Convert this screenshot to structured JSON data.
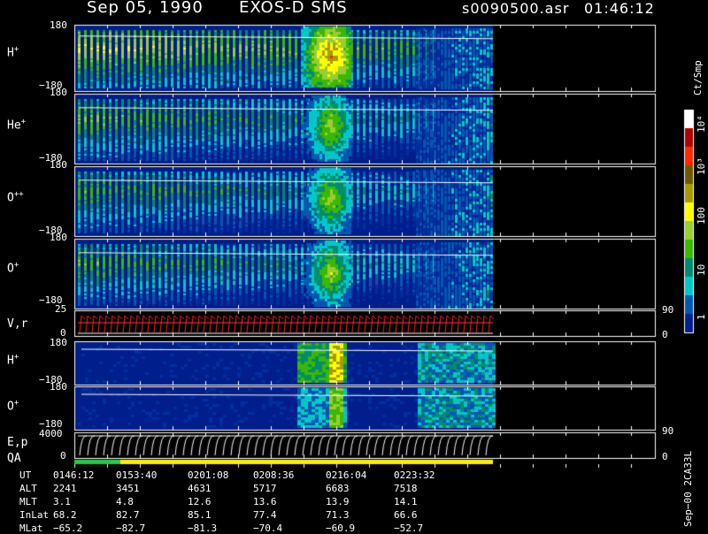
{
  "header": {
    "date": "Sep 05, 1990",
    "instrument": "EXOS-D SMS",
    "filename": "s0090500.asr",
    "time": "01:46:12"
  },
  "panels": [
    {
      "label": "H",
      "sup": "+",
      "ymax": "180",
      "ymin": "−180"
    },
    {
      "label": "He",
      "sup": "+",
      "ymax": "180",
      "ymin": "−180"
    },
    {
      "label": "O",
      "sup": "++",
      "ymax": "180",
      "ymin": "−180"
    },
    {
      "label": "O",
      "sup": "+",
      "ymax": "180",
      "ymin": "−180"
    },
    {
      "label": "V,r",
      "sup": "",
      "ymax": "25",
      "ymin": "0",
      "rmax": "90",
      "rmin": "0"
    },
    {
      "label": "H",
      "sup": "+",
      "ymax": "180",
      "ymin": "−180"
    },
    {
      "label": "O",
      "sup": "+",
      "ymax": "180",
      "ymin": "−180"
    },
    {
      "label": "E,p",
      "sup": "",
      "ymax": "4000",
      "ymin": "0",
      "rmax": "90",
      "rmin": "0"
    }
  ],
  "qa_label": "QA",
  "colorbar": {
    "unit": "Ct/Smp",
    "ticks": [
      "10⁴",
      "10³",
      "100",
      "10",
      "1"
    ],
    "colors": [
      "#ffffff",
      "#b30000",
      "#ff2a00",
      "#6b5a00",
      "#a89b00",
      "#ffff00",
      "#9acd32",
      "#3cb800",
      "#008c6e",
      "#00c8c8",
      "#0058b0",
      "#001e8c"
    ]
  },
  "footer": {
    "rows": [
      {
        "name": "UT",
        "values": [
          "0146:12",
          "0153:40",
          "0201:08",
          "0208:36",
          "0216:04",
          "0223:32"
        ]
      },
      {
        "name": "ALT",
        "values": [
          "2241",
          "3451",
          "4631",
          "5717",
          "6683",
          "7518"
        ]
      },
      {
        "name": "MLT",
        "values": [
          "3.1",
          "4.8",
          "12.6",
          "13.6",
          "13.9",
          "14.1"
        ]
      },
      {
        "name": "InLat",
        "values": [
          "68.2",
          "82.7",
          "85.1",
          "77.4",
          "71.3",
          "66.6"
        ]
      },
      {
        "name": "MLat",
        "values": [
          "−65.2",
          "−82.7",
          "−81.3",
          "−70.4",
          "−60.9",
          "−52.7"
        ]
      }
    ],
    "side_label": "Sep−00 2CA33L"
  },
  "chart_data": {
    "type": "heatmap",
    "title": "Sep 05, 1990   EXOS-D SMS",
    "x_ticks": [
      "0146:12",
      "0153:40",
      "0201:08",
      "0208:36",
      "0216:04",
      "0223:32"
    ],
    "colorbar_range": [
      1,
      10000
    ],
    "colorbar_scale": "log",
    "panels": [
      {
        "name": "H+",
        "ylim": [
          -180,
          180
        ]
      },
      {
        "name": "He+",
        "ylim": [
          -180,
          180
        ]
      },
      {
        "name": "O++",
        "ylim": [
          -180,
          180
        ]
      },
      {
        "name": "O+",
        "ylim": [
          -180,
          180
        ]
      },
      {
        "name": "V,r",
        "ylim": [
          0,
          25
        ],
        "right_ylim": [
          0,
          90
        ]
      },
      {
        "name": "H+",
        "ylim": [
          -180,
          180
        ]
      },
      {
        "name": "O+",
        "ylim": [
          -180,
          180
        ]
      },
      {
        "name": "E,p",
        "ylim": [
          0,
          4000
        ],
        "right_ylim": [
          0,
          90
        ]
      }
    ]
  }
}
